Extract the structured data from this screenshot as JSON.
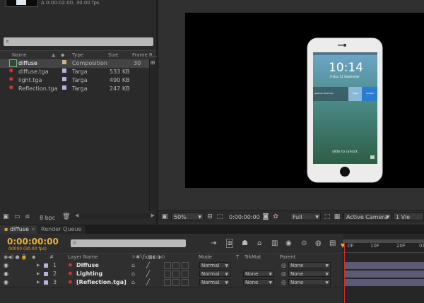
{
  "project": {
    "info": "Δ 0:00:02:00, 30.00 fps",
    "columns": {
      "name": "Name",
      "type": "Type",
      "size": "Size",
      "frame_rate": "Frame R..."
    },
    "items": [
      {
        "name": "diffuse",
        "type": "Composition",
        "size": "",
        "frame_rate": "30",
        "label_color": "#c8b58a",
        "icon": "composition-icon"
      },
      {
        "name": "diffuse.tga",
        "type": "Targa",
        "size": "533 KB",
        "frame_rate": "",
        "label_color": "#b7b1e0",
        "icon": "footage-icon"
      },
      {
        "name": "light.tga",
        "type": "Targa",
        "size": "490 KB",
        "frame_rate": "",
        "label_color": "#b7b1e0",
        "icon": "footage-icon"
      },
      {
        "name": "Reflection.tga",
        "type": "Targa",
        "size": "247 KB",
        "frame_rate": "",
        "label_color": "#b7b1e0",
        "icon": "footage-icon"
      }
    ],
    "footer": {
      "bpc": "8 bpc"
    }
  },
  "viewer": {
    "phone": {
      "time": "10:14",
      "date": "Friday 12 September",
      "notification": "Jasmine Simmons",
      "btn1": "Reply",
      "btn2": "Answer",
      "slide": "slide to unlock"
    },
    "bar": {
      "zoom": "50%",
      "timecode": "0:00:00:00",
      "resolution": "Full",
      "camera": "Active Camera",
      "views": "1 Vie"
    }
  },
  "tabs": {
    "comp": "diffuse",
    "render_queue": "Render Queue"
  },
  "timeline": {
    "timecode": "0:00:00:00",
    "fps": "00000 (30.00 fps)",
    "columns": {
      "num": "#",
      "layer_name": "Layer Name",
      "mode": "Mode",
      "t": "T",
      "trkmat": "TrkMat",
      "parent": "Parent"
    },
    "layers": [
      {
        "index": "1",
        "name": "Diffuse",
        "mode": "Normal",
        "trkmat": "",
        "parent": "None"
      },
      {
        "index": "2",
        "name": "Lighting",
        "mode": "Normal",
        "trkmat": "None",
        "parent": "None"
      },
      {
        "index": "3",
        "name": "[Reflection.tga]",
        "mode": "Normal",
        "trkmat": "None",
        "parent": "None"
      }
    ],
    "ruler": {
      "start": "0F",
      "mark10": "10F",
      "mark20": "20F",
      "mark30": "01"
    }
  },
  "colors": {
    "timecode": "#e6b23e",
    "playhead": "#d12b2b",
    "layer_bar": "#5b5b75",
    "label_lavender": "#b7b1e0"
  }
}
